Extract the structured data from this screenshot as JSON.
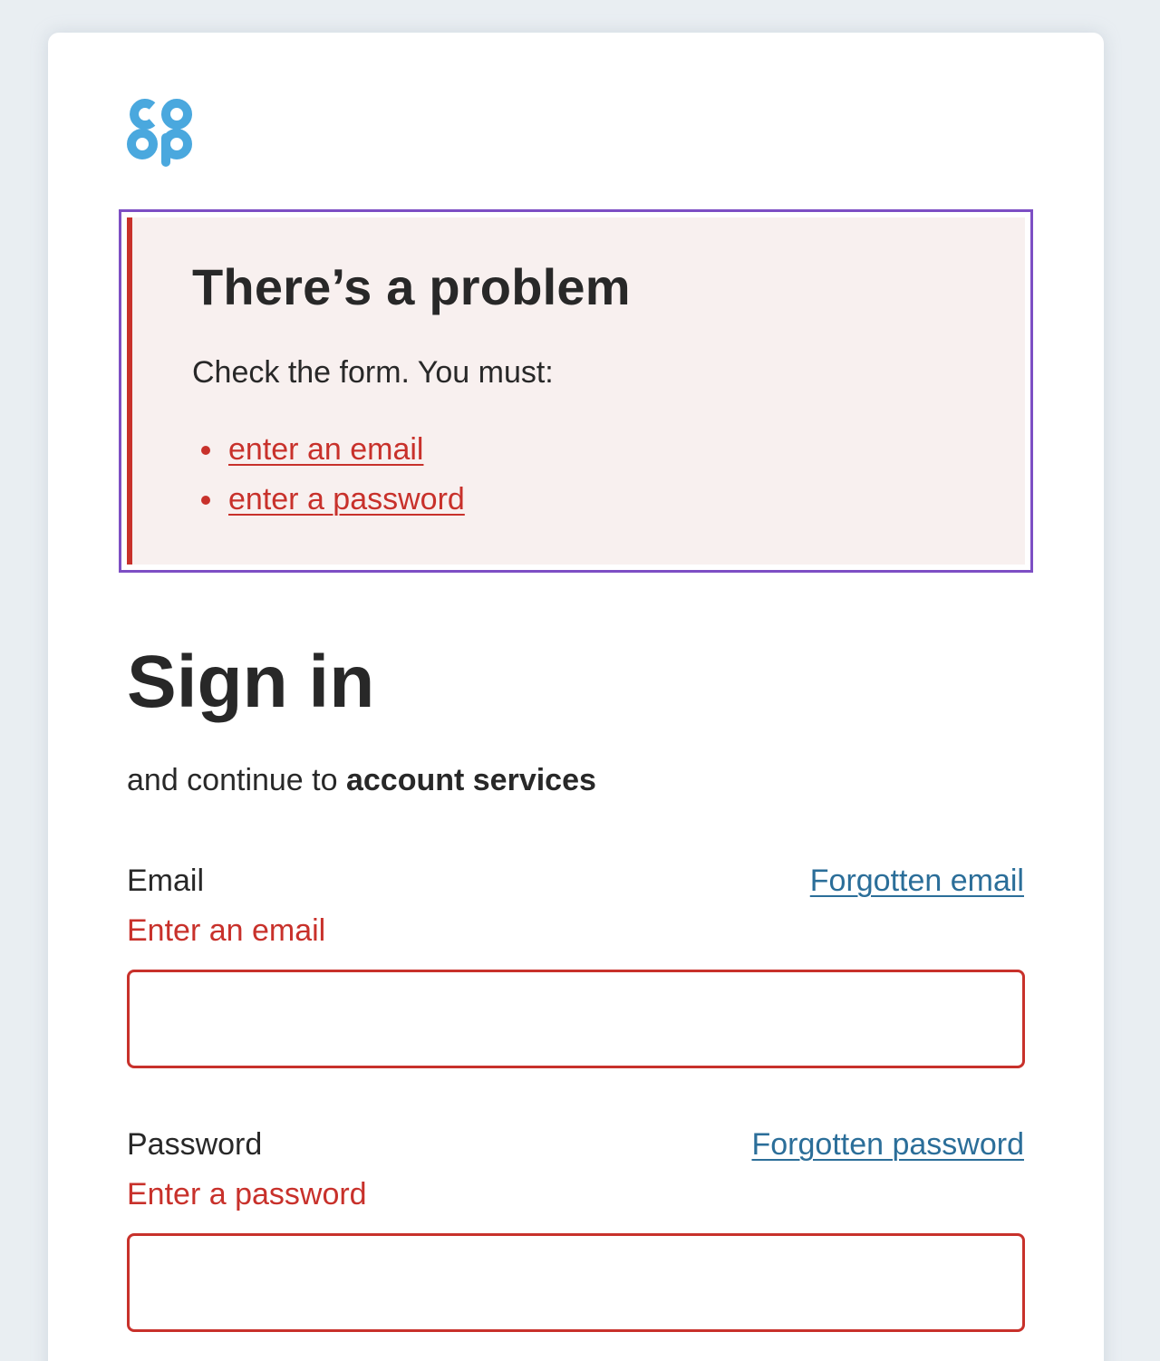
{
  "brand": {
    "logo_alt": "coop",
    "logo_color": "#4aa8de"
  },
  "error_summary": {
    "title": "There’s a problem",
    "intro": "Check the form. You must:",
    "items": [
      {
        "label": "enter an email"
      },
      {
        "label": "enter a password"
      }
    ],
    "accent_color": "#c8312b",
    "focus_color": "#7d4fc4"
  },
  "main": {
    "title": "Sign in",
    "subtitle_prefix": "and continue to ",
    "subtitle_service": "account services"
  },
  "form": {
    "email": {
      "label": "Email",
      "forgot_link": "Forgotten email",
      "error": "Enter an email",
      "value": ""
    },
    "password": {
      "label": "Password",
      "forgot_link": "Forgotten password",
      "error": "Enter a password",
      "value": ""
    }
  }
}
